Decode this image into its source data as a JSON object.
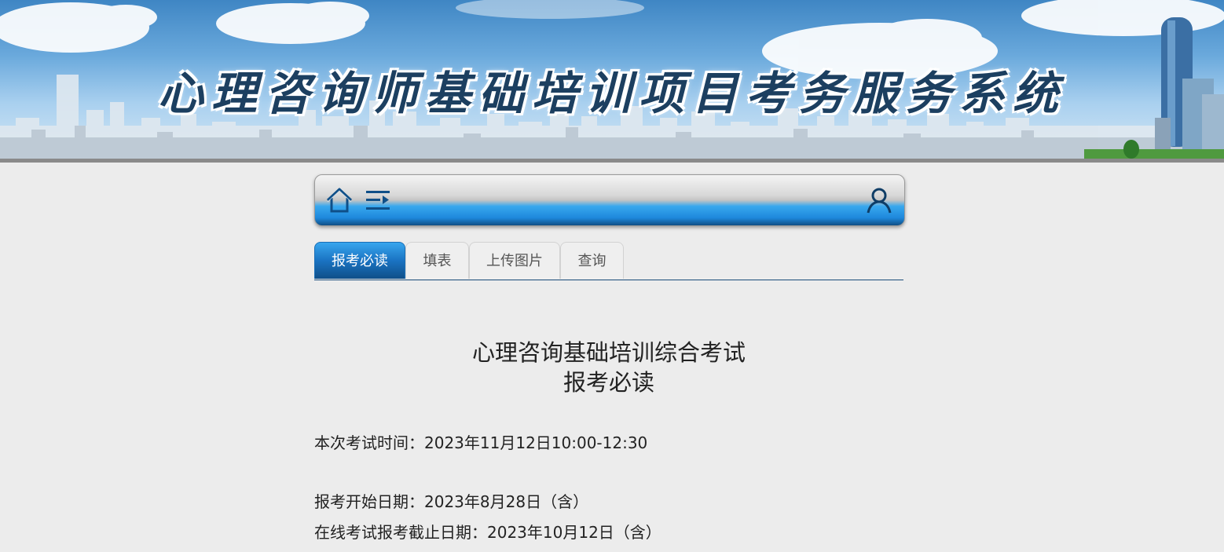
{
  "banner": {
    "title": "心理咨询师基础培训项目考务服务系统"
  },
  "navbar": {
    "icons": {
      "home": "home-icon",
      "menu": "menu-icon",
      "user": "user-icon"
    }
  },
  "tabs": [
    {
      "label": "报考必读",
      "active": true
    },
    {
      "label": "填表",
      "active": false
    },
    {
      "label": "上传图片",
      "active": false
    },
    {
      "label": "查询",
      "active": false
    }
  ],
  "document": {
    "title_line1": "心理咨询基础培训综合考试",
    "title_line2": "报考必读",
    "exam_time": "本次考试时间：2023年11月12日10:00-12:30",
    "registration_start": "报考开始日期：2023年8月28日（含）",
    "registration_deadline": "在线考试报考截止日期：2023年10月12日（含）"
  },
  "colors": {
    "accent_blue": "#1a73c2",
    "dark_blue": "#0f4f88",
    "page_bg": "#ececec"
  }
}
